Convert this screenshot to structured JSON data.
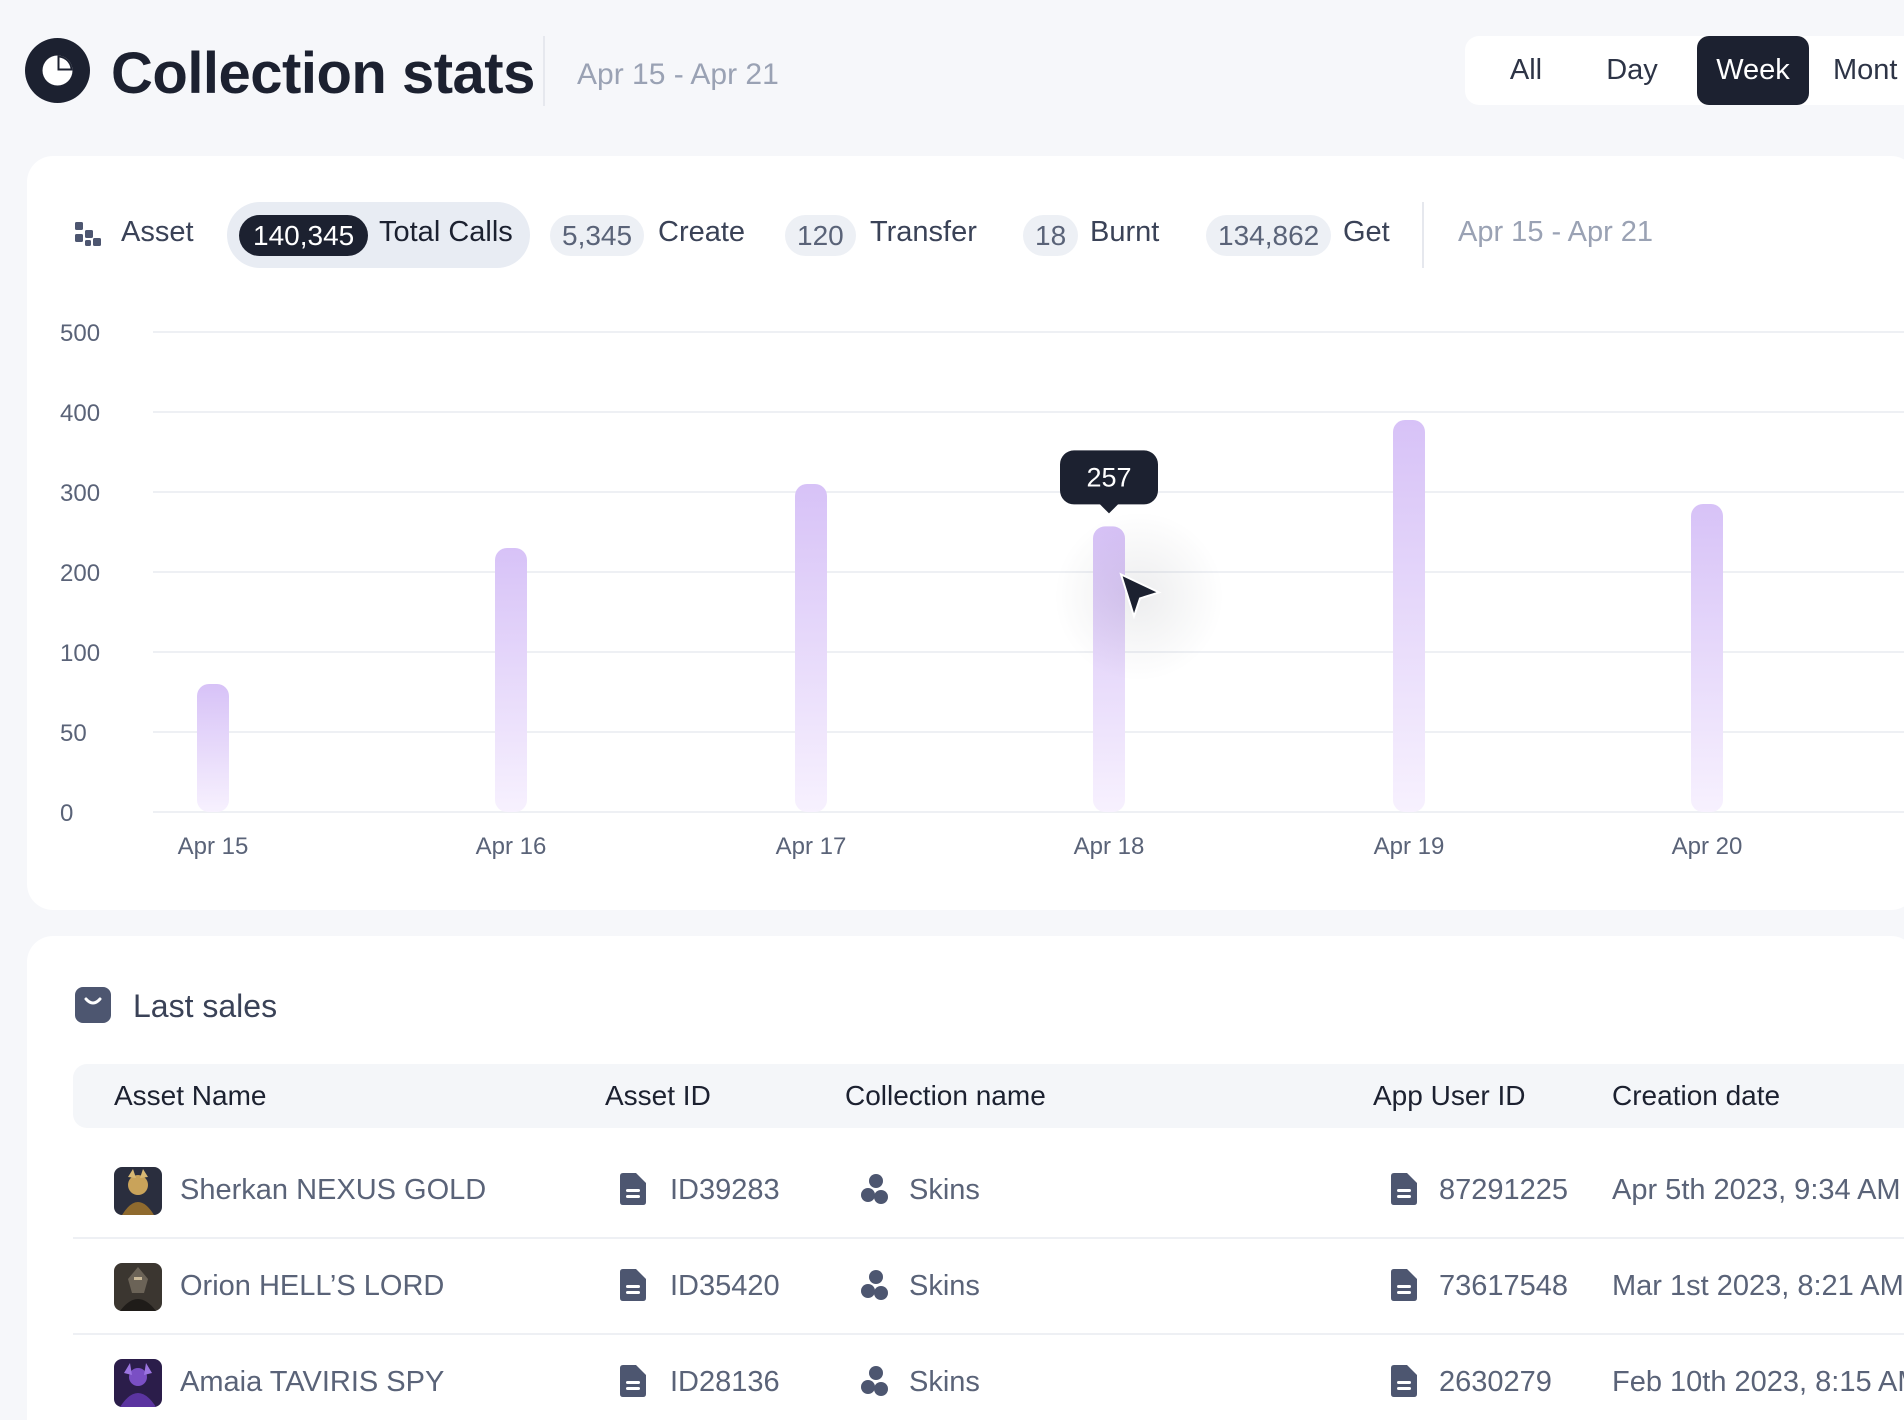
{
  "header": {
    "title": "Collection stats",
    "date_range": "Apr 15 - Apr 21",
    "periods": [
      "All",
      "Day",
      "Week",
      "Mont"
    ],
    "active_period": "Week"
  },
  "filters": {
    "asset_label": "Asset",
    "total_calls": {
      "value": "140,345",
      "label": "Total Calls"
    },
    "create": {
      "value": "5,345",
      "label": "Create"
    },
    "transfer": {
      "value": "120",
      "label": "Transfer"
    },
    "burnt": {
      "value": "18",
      "label": "Burnt"
    },
    "get": {
      "value": "134,862",
      "label": "Get"
    },
    "date_range": "Apr 15 - Apr 21"
  },
  "chart_data": {
    "type": "bar",
    "title": "",
    "xlabel": "",
    "ylabel": "",
    "y_ticks": [
      0,
      50,
      100,
      200,
      300,
      400,
      500
    ],
    "categories": [
      "Apr 15",
      "Apr 16",
      "Apr 17",
      "Apr 18",
      "Apr 19",
      "Apr 20"
    ],
    "values": [
      80,
      230,
      310,
      257,
      390,
      285
    ],
    "tooltip": {
      "category": "Apr 18",
      "label": "257"
    },
    "grid": true,
    "bar_color": "#d7c2f7"
  },
  "sales": {
    "title": "Last sales",
    "columns": [
      "Asset Name",
      "Asset ID",
      "Collection name",
      "App User ID",
      "Creation date"
    ],
    "rows": [
      {
        "asset_name": "Sherkan NEXUS GOLD",
        "asset_id": "ID39283",
        "collection": "Skins",
        "user_id": "87291225",
        "date": "Apr 5th 2023, 9:34 AM"
      },
      {
        "asset_name": "Orion HELL’S LORD",
        "asset_id": "ID35420",
        "collection": "Skins",
        "user_id": "73617548",
        "date": "Mar 1st 2023, 8:21 AM"
      },
      {
        "asset_name": "Amaia TAVIRIS SPY",
        "asset_id": "ID28136",
        "collection": "Skins",
        "user_id": "2630279",
        "date": "Feb 10th 2023, 8:15 AM"
      }
    ]
  },
  "colors": {
    "dark": "#1c2130",
    "bar_top": "#d7c2f7",
    "muted_text": "#9aa2b4",
    "background": "#f6f7fa"
  }
}
